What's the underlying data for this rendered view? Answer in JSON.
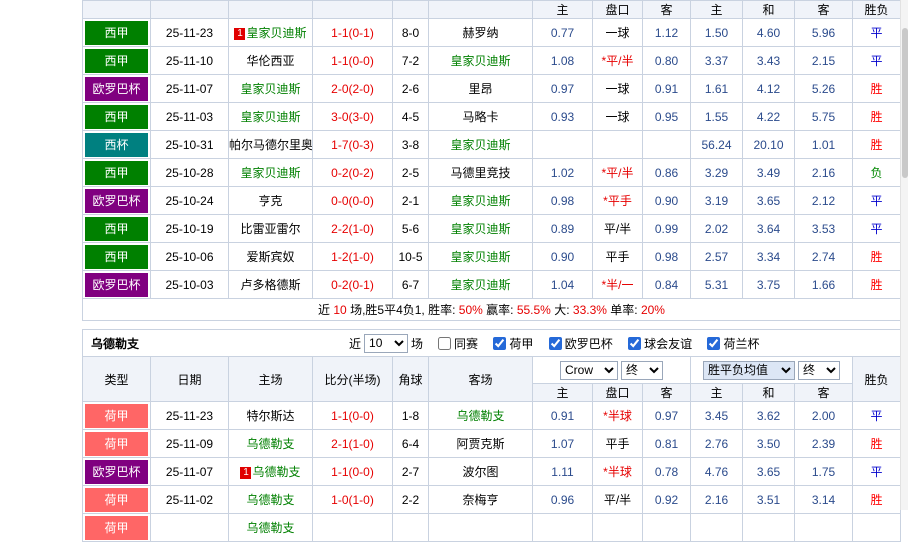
{
  "colors": {
    "badge-laliga": "#008000",
    "badge-europa": "#800080",
    "badge-copa": "#008080",
    "badge-eredivisie": "#ff6666",
    "team-green": "#008000",
    "score-red": "#e60000",
    "odds-blue": "#2b4b8c",
    "res-win": "#ff0000",
    "res-draw": "#0000cc",
    "res-lose": "#008800"
  },
  "table1": {
    "header": {
      "ah_home": "主",
      "ah_line": "盘口",
      "ah_away": "客",
      "eu_home": "主",
      "eu_draw": "和",
      "eu_away": "客",
      "result": "胜负"
    },
    "rows": [
      {
        "league": "西甲",
        "lc": "laliga",
        "date": "25-11-23",
        "marker": "1",
        "home": "皇家贝迪斯",
        "hg": true,
        "score": "1-1(0-1)",
        "corner": "8-0",
        "away": "赫罗纳",
        "ag": false,
        "ah_home": "0.77",
        "ah_line": "一球",
        "ah_red": false,
        "ah_away": "1.12",
        "eu_home": "1.50",
        "eu_draw": "4.60",
        "eu_away": "5.96",
        "result": "平",
        "rt": "draw"
      },
      {
        "league": "西甲",
        "lc": "laliga",
        "date": "25-11-10",
        "marker": "",
        "home": "华伦西亚",
        "hg": false,
        "score": "1-1(0-0)",
        "corner": "7-2",
        "away": "皇家贝迪斯",
        "ag": true,
        "ah_home": "1.08",
        "ah_line": "*平/半",
        "ah_red": true,
        "ah_away": "0.80",
        "eu_home": "3.37",
        "eu_draw": "3.43",
        "eu_away": "2.15",
        "result": "平",
        "rt": "draw"
      },
      {
        "league": "欧罗巴杯",
        "lc": "europa",
        "date": "25-11-07",
        "marker": "",
        "home": "皇家贝迪斯",
        "hg": true,
        "score": "2-0(2-0)",
        "corner": "2-6",
        "away": "里昂",
        "ag": false,
        "ah_home": "0.97",
        "ah_line": "一球",
        "ah_red": false,
        "ah_away": "0.91",
        "eu_home": "1.61",
        "eu_draw": "4.12",
        "eu_away": "5.26",
        "result": "胜",
        "rt": "win"
      },
      {
        "league": "西甲",
        "lc": "laliga",
        "date": "25-11-03",
        "marker": "",
        "home": "皇家贝迪斯",
        "hg": true,
        "score": "3-0(3-0)",
        "corner": "4-5",
        "away": "马略卡",
        "ag": false,
        "ah_home": "0.93",
        "ah_line": "一球",
        "ah_red": false,
        "ah_away": "0.95",
        "eu_home": "1.55",
        "eu_draw": "4.22",
        "eu_away": "5.75",
        "result": "胜",
        "rt": "win"
      },
      {
        "league": "西杯",
        "lc": "copa",
        "date": "25-10-31",
        "marker": "",
        "home": "帕尔马德尔里奥",
        "hg": false,
        "score": "1-7(0-3)",
        "corner": "3-8",
        "away": "皇家贝迪斯",
        "ag": true,
        "ah_home": "",
        "ah_line": "",
        "ah_red": false,
        "ah_away": "",
        "eu_home": "56.24",
        "eu_draw": "20.10",
        "eu_away": "1.01",
        "result": "胜",
        "rt": "win"
      },
      {
        "league": "西甲",
        "lc": "laliga",
        "date": "25-10-28",
        "marker": "",
        "home": "皇家贝迪斯",
        "hg": true,
        "score": "0-2(0-2)",
        "corner": "2-5",
        "away": "马德里竞技",
        "ag": false,
        "ah_home": "1.02",
        "ah_line": "*平/半",
        "ah_red": true,
        "ah_away": "0.86",
        "eu_home": "3.29",
        "eu_draw": "3.49",
        "eu_away": "2.16",
        "result": "负",
        "rt": "lose"
      },
      {
        "league": "欧罗巴杯",
        "lc": "europa",
        "date": "25-10-24",
        "marker": "",
        "home": "亨克",
        "hg": false,
        "score": "0-0(0-0)",
        "corner": "2-1",
        "away": "皇家贝迪斯",
        "ag": true,
        "ah_home": "0.98",
        "ah_line": "*平手",
        "ah_red": true,
        "ah_away": "0.90",
        "eu_home": "3.19",
        "eu_draw": "3.65",
        "eu_away": "2.12",
        "result": "平",
        "rt": "draw"
      },
      {
        "league": "西甲",
        "lc": "laliga",
        "date": "25-10-19",
        "marker": "",
        "home": "比雷亚雷尔",
        "hg": false,
        "score": "2-2(1-0)",
        "corner": "5-6",
        "away": "皇家贝迪斯",
        "ag": true,
        "ah_home": "0.89",
        "ah_line": "平/半",
        "ah_red": false,
        "ah_away": "0.99",
        "eu_home": "2.02",
        "eu_draw": "3.64",
        "eu_away": "3.53",
        "result": "平",
        "rt": "draw"
      },
      {
        "league": "西甲",
        "lc": "laliga",
        "date": "25-10-06",
        "marker": "",
        "home": "爱斯宾奴",
        "hg": false,
        "score": "1-2(1-0)",
        "corner": "10-5",
        "away": "皇家贝迪斯",
        "ag": true,
        "ah_home": "0.90",
        "ah_line": "平手",
        "ah_red": false,
        "ah_away": "0.98",
        "eu_home": "2.57",
        "eu_draw": "3.34",
        "eu_away": "2.74",
        "result": "胜",
        "rt": "win"
      },
      {
        "league": "欧罗巴杯",
        "lc": "europa",
        "date": "25-10-03",
        "marker": "",
        "home": "卢多格德斯",
        "hg": false,
        "score": "0-2(0-1)",
        "corner": "6-7",
        "away": "皇家贝迪斯",
        "ag": true,
        "ah_home": "1.04",
        "ah_line": "*半/一",
        "ah_red": true,
        "ah_away": "0.84",
        "eu_home": "5.31",
        "eu_draw": "3.75",
        "eu_away": "1.66",
        "result": "胜",
        "rt": "win"
      }
    ],
    "summary_parts": [
      {
        "t": "近"
      },
      {
        "t": "10",
        "red": true
      },
      {
        "t": "场,胜5平4负1, 胜率:"
      },
      {
        "t": "50%",
        "red": true
      },
      {
        "t": " 赢率:"
      },
      {
        "t": "55.5%",
        "red": true
      },
      {
        "t": " 大:"
      },
      {
        "t": "33.3%",
        "red": true
      },
      {
        "t": " 单率:"
      },
      {
        "t": "20%",
        "red": true
      }
    ]
  },
  "table2": {
    "section": {
      "team": "乌德勒支",
      "recent_label": "近",
      "recent_value": "10",
      "games_label": "场",
      "filters": [
        {
          "label": "同赛",
          "checked": false
        },
        {
          "label": "荷甲",
          "checked": true
        },
        {
          "label": "欧罗巴杯",
          "checked": true
        },
        {
          "label": "球会友谊",
          "checked": true
        },
        {
          "label": "荷兰杯",
          "checked": true
        }
      ]
    },
    "controls": {
      "company": "Crow",
      "final1": "终",
      "avg": "胜平负均值",
      "final2": "终"
    },
    "header": {
      "type": "类型",
      "date": "日期",
      "home": "主场",
      "score": "比分(半场)",
      "corner": "角球",
      "away": "客场",
      "ah_home": "主",
      "ah_line": "盘口",
      "ah_away": "客",
      "eu_home": "主",
      "eu_draw": "和",
      "eu_away": "客",
      "result": "胜负"
    },
    "rows": [
      {
        "league": "荷甲",
        "lc": "eredivisie",
        "date": "25-11-23",
        "marker": "",
        "home": "特尔斯达",
        "hg": false,
        "score": "1-1(0-0)",
        "corner": "1-8",
        "away": "乌德勒支",
        "ag": true,
        "ah_home": "0.91",
        "ah_line": "*半球",
        "ah_red": true,
        "ah_away": "0.97",
        "eu_home": "3.45",
        "eu_draw": "3.62",
        "eu_away": "2.00",
        "result": "平",
        "rt": "draw"
      },
      {
        "league": "荷甲",
        "lc": "eredivisie",
        "date": "25-11-09",
        "marker": "",
        "home": "乌德勒支",
        "hg": true,
        "score": "2-1(1-0)",
        "corner": "6-4",
        "away": "阿贾克斯",
        "ag": false,
        "ah_home": "1.07",
        "ah_line": "平手",
        "ah_red": false,
        "ah_away": "0.81",
        "eu_home": "2.76",
        "eu_draw": "3.50",
        "eu_away": "2.39",
        "result": "胜",
        "rt": "win"
      },
      {
        "league": "欧罗巴杯",
        "lc": "europa",
        "date": "25-11-07",
        "marker": "1",
        "home": "乌德勒支",
        "hg": true,
        "score": "1-1(0-0)",
        "corner": "2-7",
        "away": "波尔图",
        "ag": false,
        "ah_home": "1.11",
        "ah_line": "*半球",
        "ah_red": true,
        "ah_away": "0.78",
        "eu_home": "4.76",
        "eu_draw": "3.65",
        "eu_away": "1.75",
        "result": "平",
        "rt": "draw"
      },
      {
        "league": "荷甲",
        "lc": "eredivisie",
        "date": "25-11-02",
        "marker": "",
        "home": "乌德勒支",
        "hg": true,
        "score": "1-0(1-0)",
        "corner": "2-2",
        "away": "奈梅亨",
        "ag": false,
        "ah_home": "0.96",
        "ah_line": "平/半",
        "ah_red": false,
        "ah_away": "0.92",
        "eu_home": "2.16",
        "eu_draw": "3.51",
        "eu_away": "3.14",
        "result": "胜",
        "rt": "win"
      },
      {
        "league": "荷甲",
        "lc": "eredivisie",
        "date": "",
        "marker": "",
        "home": "乌德勒支",
        "hg": true,
        "score": "",
        "corner": "",
        "away": "",
        "ag": false,
        "ah_home": "",
        "ah_line": "",
        "ah_red": false,
        "ah_away": "",
        "eu_home": "",
        "eu_draw": "",
        "eu_away": "",
        "result": ""
      }
    ]
  }
}
